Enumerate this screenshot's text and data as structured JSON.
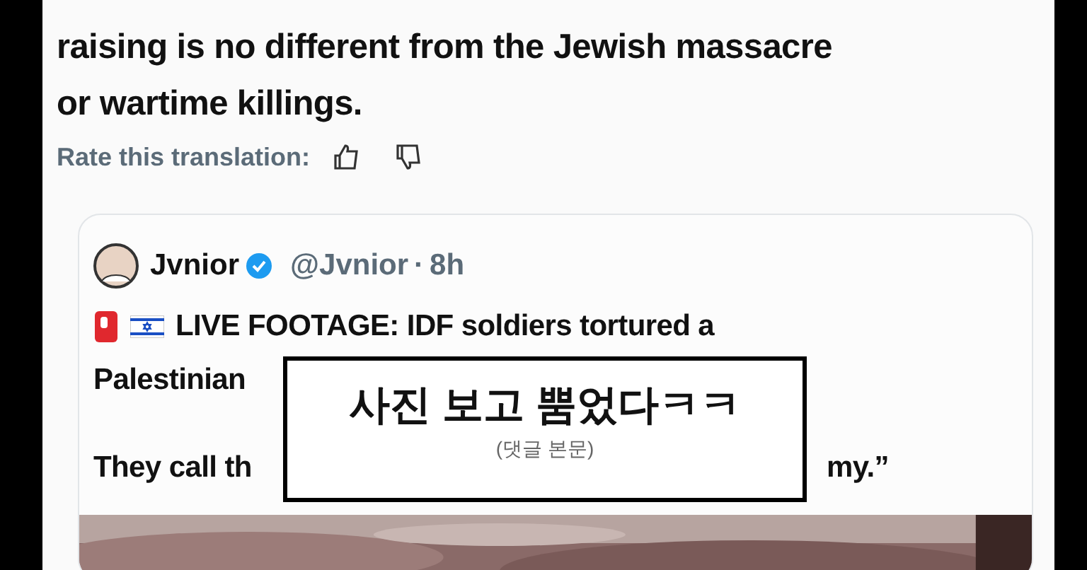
{
  "translation": {
    "lines": [
      "raising is no different from the Jewish massacre",
      "or wartime killings."
    ],
    "rate_label": "Rate this translation:"
  },
  "quoted_post": {
    "name": "Jvnior",
    "verified": true,
    "handle": "@Jvnior",
    "separator": "·",
    "time": "8h",
    "lines": [
      {
        "before": "LIVE FOOTAGE: IDF soldiers tortured a"
      },
      {
        "before": "Palestinian"
      },
      {
        "before": "They call th",
        "after": "my.”"
      }
    ]
  },
  "caption": {
    "title": "사진 보고 뿜었다ㅋㅋ",
    "subtitle": "(댓글 본문)"
  }
}
